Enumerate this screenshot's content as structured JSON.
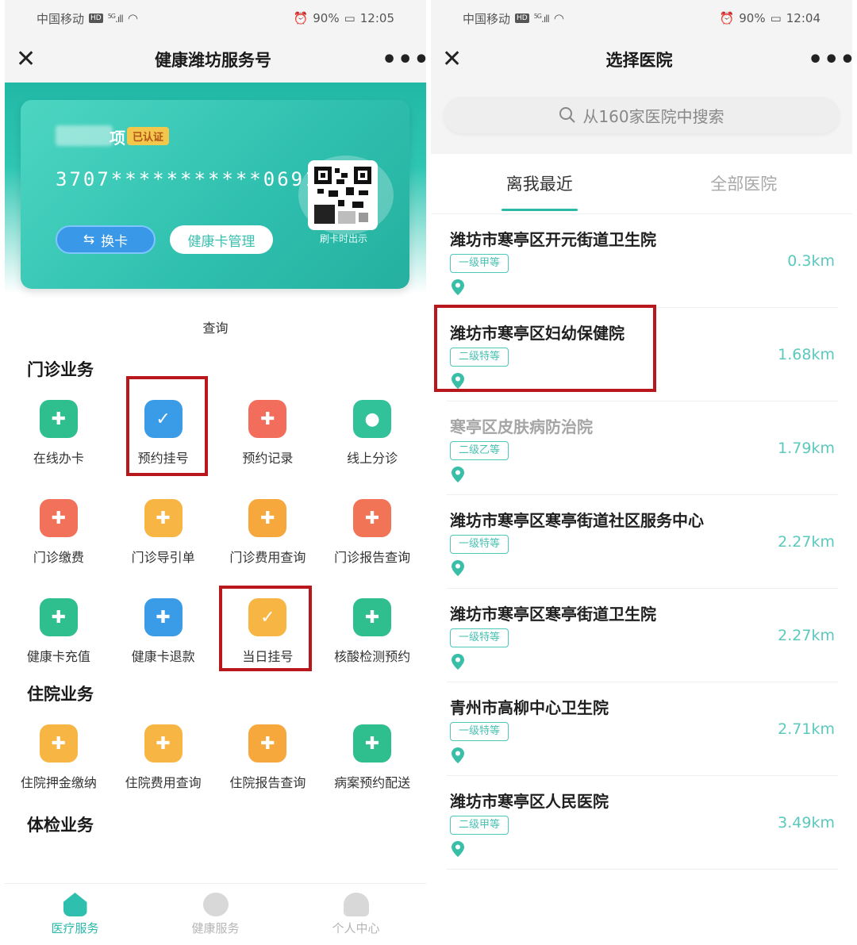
{
  "left": {
    "status": {
      "carrier": "中国移动",
      "hd": "HD",
      "network": "5G",
      "battery": "90%",
      "time": "12:05"
    },
    "nav": {
      "title": "健康潍坊服务号",
      "close": "✕",
      "more": "•••"
    },
    "card": {
      "name_tail": "项",
      "verified": "已认证",
      "number": "3707***********0691",
      "switch_label": "换卡",
      "switch_icon": "⇆",
      "manage_label": "健康卡管理",
      "qr_caption": "刷卡时出示"
    },
    "query_label": "查询",
    "outpatient": {
      "title": "门诊业务",
      "items": [
        {
          "label": "在线办卡",
          "icon": "card-plus-icon",
          "color": "#2fbf8f"
        },
        {
          "label": "预约挂号",
          "icon": "calendar-check-icon",
          "color": "#3a9be6"
        },
        {
          "label": "预约记录",
          "icon": "record-icon",
          "color": "#f26d5b"
        },
        {
          "label": "线上分诊",
          "icon": "doctor-icon",
          "color": "#32c29a"
        },
        {
          "label": "门诊缴费",
          "icon": "payment-icon",
          "color": "#f2715a"
        },
        {
          "label": "门诊导引单",
          "icon": "guide-icon",
          "color": "#f7b544"
        },
        {
          "label": "门诊费用查询",
          "icon": "fee-query-icon",
          "color": "#f7a83c"
        },
        {
          "label": "门诊报告查询",
          "icon": "report-icon",
          "color": "#f27457"
        },
        {
          "label": "健康卡充值",
          "icon": "recharge-icon",
          "color": "#2fbf8f"
        },
        {
          "label": "健康卡退款",
          "icon": "refund-icon",
          "color": "#3a9be6"
        },
        {
          "label": "当日挂号",
          "icon": "today-register-icon",
          "color": "#f7b544"
        },
        {
          "label": "核酸检测预约",
          "icon": "nucleic-test-icon",
          "color": "#2fbf8f"
        }
      ]
    },
    "inpatient": {
      "title": "住院业务",
      "items": [
        {
          "label": "住院押金缴纳",
          "icon": "deposit-icon",
          "color": "#f7b544"
        },
        {
          "label": "住院费用查询",
          "icon": "inpatient-fee-icon",
          "color": "#f7b544"
        },
        {
          "label": "住院报告查询",
          "icon": "inpatient-report-icon",
          "color": "#f7a83c"
        },
        {
          "label": "病案预约配送",
          "icon": "delivery-icon",
          "color": "#2fbf8f"
        }
      ]
    },
    "checkup": {
      "title": "体检业务"
    },
    "tabs": [
      {
        "label": "医疗服务",
        "active": true
      },
      {
        "label": "健康服务",
        "active": false
      },
      {
        "label": "个人中心",
        "active": false
      }
    ]
  },
  "right": {
    "status": {
      "carrier": "中国移动",
      "hd": "HD",
      "network": "5G",
      "battery": "90%",
      "time": "12:04"
    },
    "nav": {
      "title": "选择医院",
      "close": "✕",
      "more": "•••"
    },
    "search": {
      "placeholder": "从160家医院中搜索"
    },
    "tabs": [
      {
        "label": "离我最近",
        "active": true
      },
      {
        "label": "全部医院",
        "active": false
      }
    ],
    "hospitals": [
      {
        "name": "潍坊市寒亭区开元街道卫生院",
        "level": "一级甲等",
        "distance": "0.3km",
        "dim": false
      },
      {
        "name": "潍坊市寒亭区妇幼保健院",
        "level": "二级特等",
        "distance": "1.68km",
        "dim": false
      },
      {
        "name": "寒亭区皮肤病防治院",
        "level": "二级乙等",
        "distance": "1.79km",
        "dim": true
      },
      {
        "name": "潍坊市寒亭区寒亭街道社区服务中心",
        "level": "一级特等",
        "distance": "2.27km",
        "dim": false
      },
      {
        "name": "潍坊市寒亭区寒亭街道卫生院",
        "level": "一级特等",
        "distance": "2.27km",
        "dim": false
      },
      {
        "name": "青州市高柳中心卫生院",
        "level": "一级特等",
        "distance": "2.71km",
        "dim": false
      },
      {
        "name": "潍坊市寒亭区人民医院",
        "level": "二级甲等",
        "distance": "3.49km",
        "dim": false
      }
    ]
  },
  "colors": {
    "accent": "#2cbaa8",
    "highlight": "#b8181c"
  }
}
